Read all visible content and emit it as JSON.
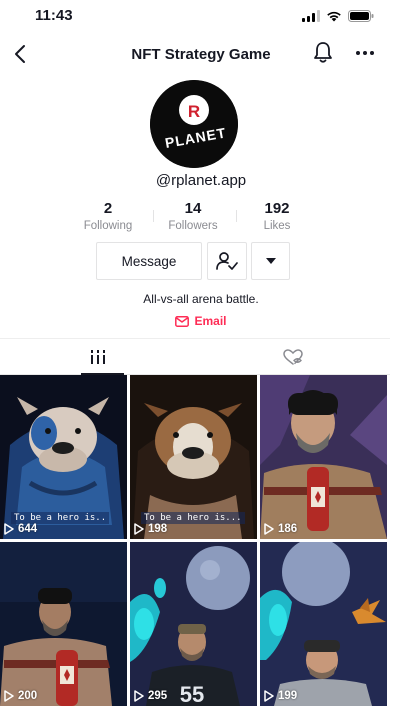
{
  "status_bar": {
    "time": "11:43"
  },
  "header": {
    "title": "NFT Strategy Game"
  },
  "profile": {
    "avatar_text_top": "R",
    "avatar_text_bottom": "PLANET",
    "username": "@rplanet.app",
    "stats": [
      {
        "value": "2",
        "label": "Following"
      },
      {
        "value": "14",
        "label": "Followers"
      },
      {
        "value": "192",
        "label": "Likes"
      }
    ],
    "message_label": "Message",
    "bio": "All-vs-all arena battle.",
    "email_label": "Email"
  },
  "colors": {
    "accent": "#fe2c55",
    "text": "#161823",
    "muted": "#8a8b91"
  },
  "videos": [
    {
      "plays": "644",
      "caption": "To be a hero is..",
      "thumb": "bulldog-blue-hood"
    },
    {
      "plays": "198",
      "caption": "To be a hero is...",
      "thumb": "bulldog-brown"
    },
    {
      "plays": "186",
      "caption": "",
      "thumb": "bearded-man-beanie-bottle"
    },
    {
      "plays": "200",
      "caption": "",
      "thumb": "bearded-man-dark"
    },
    {
      "plays": "295",
      "caption": "",
      "thumb": "man-planet-jersey"
    },
    {
      "plays": "199",
      "caption": "",
      "thumb": "man-planet-spaceship"
    }
  ]
}
